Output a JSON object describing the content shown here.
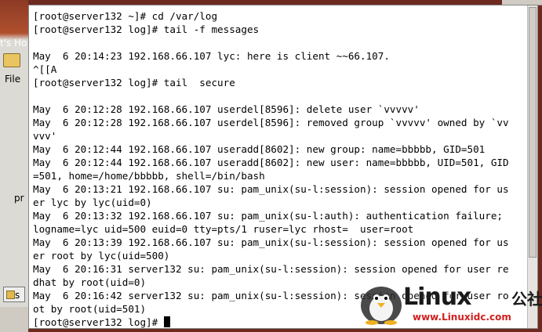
{
  "desktop": {
    "partial_text": "t's Ho",
    "file_menu": "File",
    "pr_text": "pr",
    "s_item": "s"
  },
  "terminal": {
    "lines": [
      "[root@server132 ~]# cd /var/log",
      "[root@server132 log]# tail -f messages",
      "",
      "May  6 20:14:23 192.168.66.107 lyc: here is client ~~66.107.",
      "^[[A",
      "[root@server132 log]# tail  secure",
      "",
      "May  6 20:12:28 192.168.66.107 userdel[8596]: delete user `vvvvv'",
      "May  6 20:12:28 192.168.66.107 userdel[8596]: removed group `vvvvv' owned by `vv",
      "vvv'",
      "May  6 20:12:44 192.168.66.107 useradd[8602]: new group: name=bbbbb, GID=501",
      "May  6 20:12:44 192.168.66.107 useradd[8602]: new user: name=bbbbb, UID=501, GID",
      "=501, home=/home/bbbbb, shell=/bin/bash",
      "May  6 20:13:21 192.168.66.107 su: pam_unix(su-l:session): session opened for us",
      "er lyc by lyc(uid=0)",
      "May  6 20:13:32 192.168.66.107 su: pam_unix(su-l:auth): authentication failure;",
      "logname=lyc uid=500 euid=0 tty=pts/1 ruser=lyc rhost=  user=root",
      "May  6 20:13:39 192.168.66.107 su: pam_unix(su-l:session): session opened for us",
      "er root by lyc(uid=500)",
      "May  6 20:16:31 server132 su: pam_unix(su-l:session): session opened for user re",
      "dhat by root(uid=0)",
      "May  6 20:16:42 server132 su: pam_unix(su-l:session): session opened for user ro",
      "ot by root(uid=501)"
    ],
    "prompt": "[root@server132 log]# "
  },
  "watermark": {
    "brand": "Linux",
    "brand_suffix": "公社",
    "url": "www.Linuxidc.com"
  }
}
